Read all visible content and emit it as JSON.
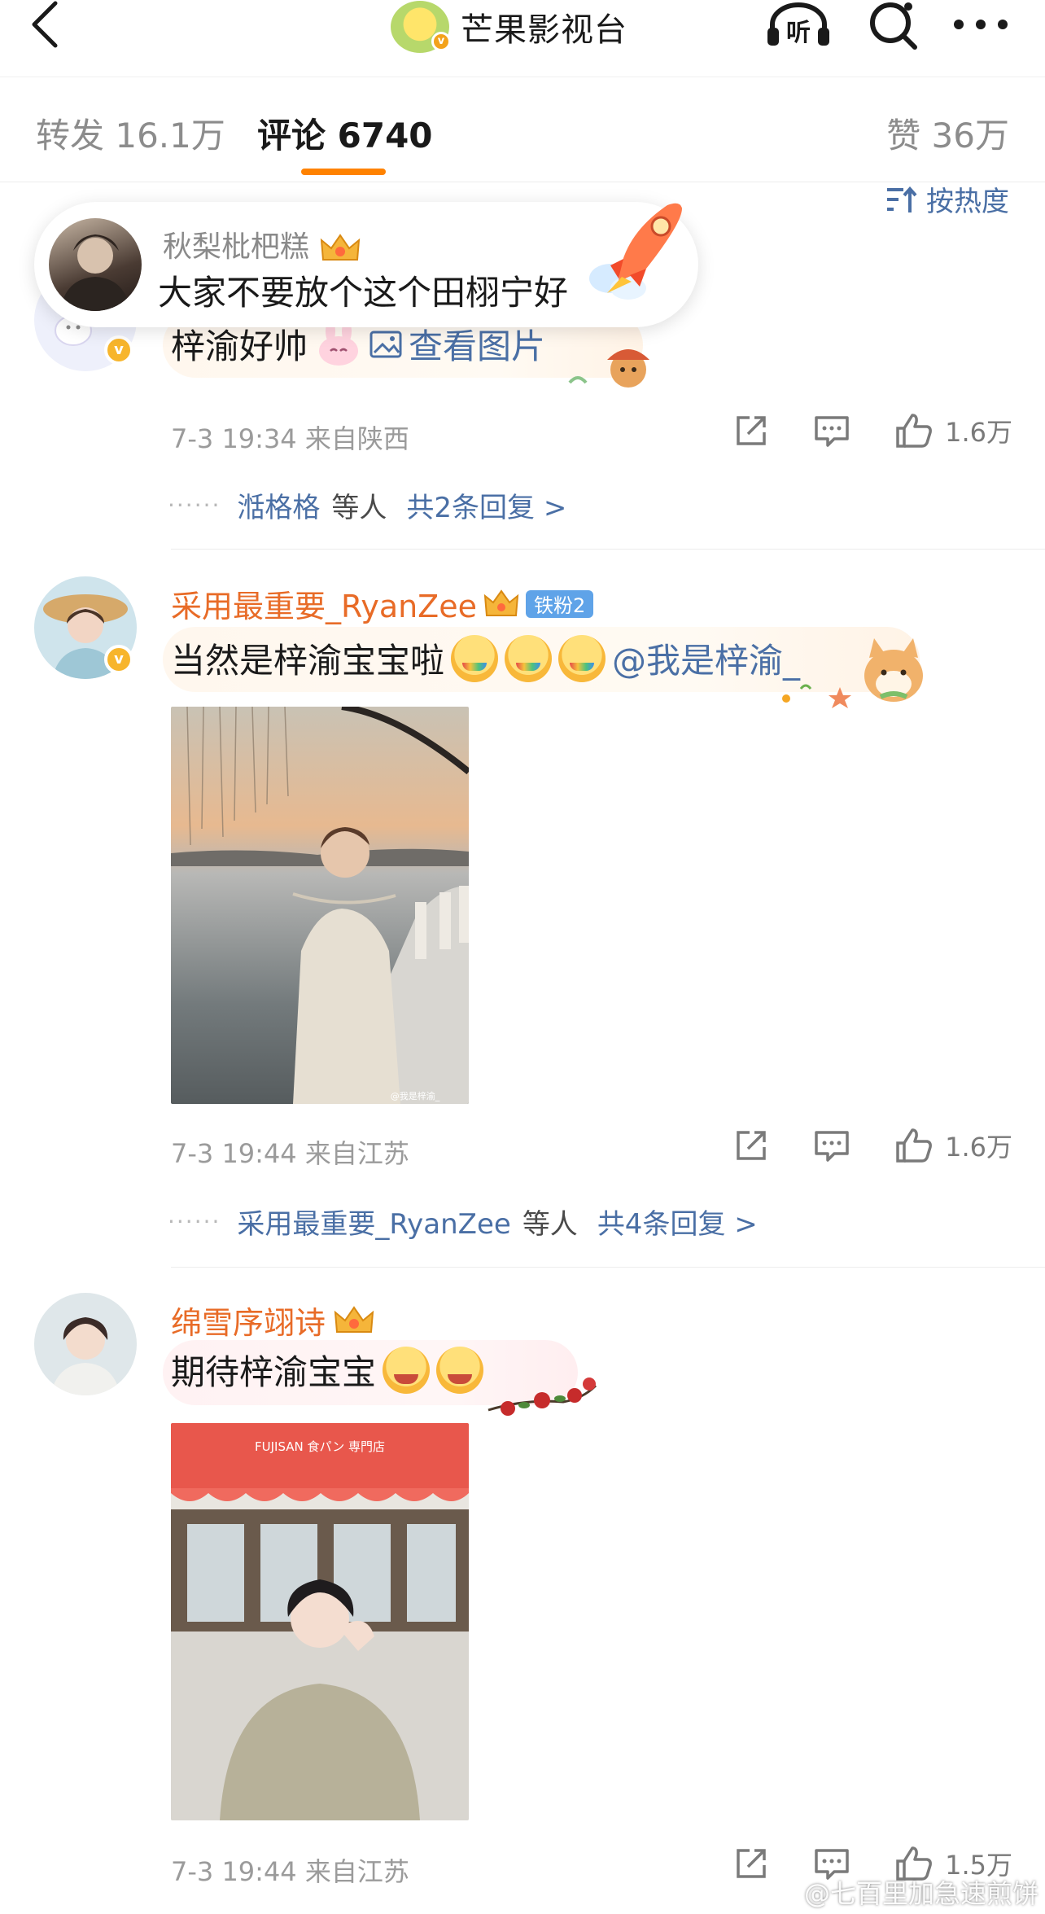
{
  "header": {
    "title": "芒果影视台",
    "listen_label": "听"
  },
  "tabs": {
    "repost": "转发 16.1万",
    "comments": "评论 6740",
    "likes": "赞 36万"
  },
  "sort_label": "按热度",
  "toast": {
    "name": "秋梨枇杷糕",
    "text": "大家不要放个这个田栩宁好"
  },
  "comments": [
    {
      "text": "梓渝好帅",
      "link": "查看图片",
      "time_location": "7-3 19:34  来自陕西",
      "likes": "1.6万",
      "reply_user": "湉格格",
      "reply_etc": "等人",
      "reply_count": "共2条回复 >"
    },
    {
      "username": "采用最重要_RyanZee",
      "fan_badge": "铁粉2",
      "text": "当然是梓渝宝宝啦",
      "mention": "@我是梓渝_",
      "time_location": "7-3 19:44  来自江苏",
      "likes": "1.6万",
      "reply_user": "采用最重要_RyanZee",
      "reply_etc": "等人",
      "reply_count": "共4条回复 >",
      "photo_caption": "@我是梓渝_"
    },
    {
      "username": "绵雪序翊诗",
      "text": "期待梓渝宝宝",
      "shop_sign": "FUJISAN 食パン 専門店",
      "time_location": "7-3 19:44  来自江苏",
      "likes": "1.5万"
    }
  ],
  "watermark": "@七百里加急速煎饼",
  "colors": {
    "accent": "#ff8200",
    "username": "#e86b27",
    "link": "#4a6fa5",
    "fan_badge": "#5fa3e8"
  }
}
